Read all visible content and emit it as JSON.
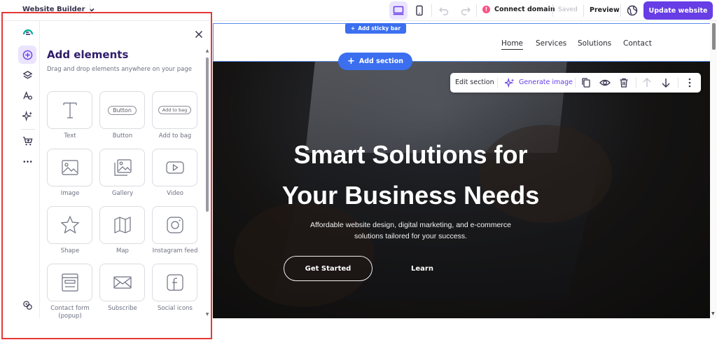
{
  "topbar": {
    "title": "Website Builder",
    "connect_domain": "Connect domain",
    "saved": "Saved",
    "preview": "Preview",
    "update_website": "Update website"
  },
  "rail": {
    "icons": [
      "add-elements-icon",
      "layers-icon",
      "styles-icon",
      "ai-tools-icon",
      "store-icon",
      "more-icon",
      "integrations-icon"
    ]
  },
  "panel": {
    "title": "Add elements",
    "subtitle": "Drag and drop elements anywhere on your page",
    "mini_button_text": "Button",
    "mini_bag_text": "Add to bag",
    "elements": [
      {
        "label": "Text"
      },
      {
        "label": "Button"
      },
      {
        "label": "Add to bag"
      },
      {
        "label": "Image"
      },
      {
        "label": "Gallery"
      },
      {
        "label": "Video"
      },
      {
        "label": "Shape"
      },
      {
        "label": "Map"
      },
      {
        "label": "Instagram feed"
      },
      {
        "label": "Contact form (popup)"
      },
      {
        "label": "Subscribe"
      },
      {
        "label": "Social icons"
      }
    ]
  },
  "site": {
    "add_sticky_bar": "Add sticky bar",
    "add_section": "Add section",
    "nav": [
      "Home",
      "Services",
      "Solutions",
      "Contact"
    ],
    "toolbar": {
      "edit_section": "Edit section",
      "generate_image": "Generate image"
    },
    "hero": {
      "title_line1": "Smart Solutions for",
      "title_line2": "Your Business Needs",
      "subtitle_line1": "Affordable website design, digital marketing, and e-commerce",
      "subtitle_line2": "solutions tailored for your success.",
      "cta_primary": "Get Started",
      "cta_secondary": "Learn"
    }
  },
  "colors": {
    "brand": "#673de6",
    "selection": "#e53935",
    "editor_blue": "#3b6ff0",
    "warning": "#fc5185"
  }
}
